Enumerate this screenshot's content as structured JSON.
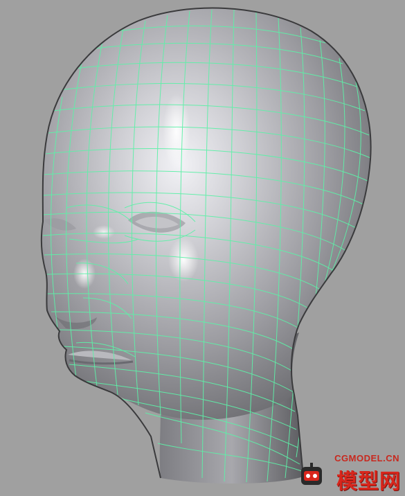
{
  "viewport": {
    "background": "#a0a0a0",
    "wire_color": "#5ef0a8",
    "model": "head-wireframe"
  },
  "watermark": {
    "domain": "CGMODEL.CN",
    "name": "模型网",
    "color": "#d8261c",
    "logo_icon": "robot-logo-icon"
  }
}
